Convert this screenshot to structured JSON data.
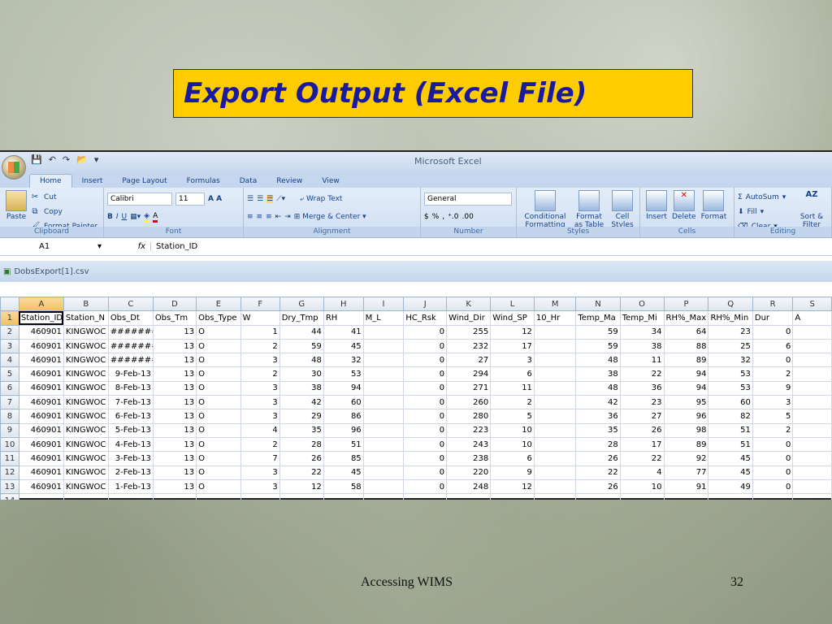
{
  "slide": {
    "title": "Export Output (Excel File)",
    "footer": "Accessing WIMS",
    "page": "32"
  },
  "excel": {
    "app_title": "Microsoft Excel",
    "tabs": [
      "Home",
      "Insert",
      "Page Layout",
      "Formulas",
      "Data",
      "Review",
      "View"
    ],
    "clipboard": {
      "paste": "Paste",
      "cut": "Cut",
      "copy": "Copy",
      "format_painter": "Format Painter",
      "label": "Clipboard"
    },
    "font": {
      "name": "Calibri",
      "size": "11",
      "bold": "B",
      "italic": "I",
      "underline": "U",
      "label": "Font"
    },
    "alignment": {
      "wrap": "Wrap Text",
      "merge": "Merge & Center",
      "label": "Alignment"
    },
    "number": {
      "format": "General",
      "currency": "$",
      "percent": "%",
      "comma": ",",
      "label": "Number"
    },
    "styles": {
      "conditional": "Conditional Formatting",
      "table": "Format as Table",
      "cell": "Cell Styles",
      "label": "Styles"
    },
    "cells": {
      "insert": "Insert",
      "delete": "Delete",
      "format": "Format",
      "label": "Cells"
    },
    "editing": {
      "autosum": "AutoSum",
      "fill": "Fill",
      "clear": "Clear",
      "sort": "Sort & Filter",
      "label": "Editing"
    },
    "name_box": "A1",
    "fx": "fx",
    "formula": "Station_ID",
    "workbook": "DobsExport[1].csv",
    "columns": [
      "A",
      "B",
      "C",
      "D",
      "E",
      "F",
      "G",
      "H",
      "I",
      "J",
      "K",
      "L",
      "M",
      "N",
      "O",
      "P",
      "Q",
      "R",
      "S"
    ],
    "rows": [
      [
        "Station_ID",
        "Station_N",
        "Obs_Dt",
        "Obs_Tm",
        "Obs_Type",
        "W",
        "Dry_Tmp",
        "RH",
        "M_L",
        "HC_Rsk",
        "Wind_Dir",
        "Wind_SP",
        "10_Hr",
        "Temp_Ma",
        "Temp_Mi",
        "RH%_Max",
        "RH%_Min",
        "Dur",
        "A"
      ],
      [
        "460901",
        "KINGWOC",
        "########",
        "13",
        "O",
        "1",
        "44",
        "41",
        "",
        "0",
        "255",
        "12",
        "",
        "59",
        "34",
        "64",
        "23",
        "0",
        ""
      ],
      [
        "460901",
        "KINGWOC",
        "########",
        "13",
        "O",
        "2",
        "59",
        "45",
        "",
        "0",
        "232",
        "17",
        "",
        "59",
        "38",
        "88",
        "25",
        "6",
        ""
      ],
      [
        "460901",
        "KINGWOC",
        "########",
        "13",
        "O",
        "3",
        "48",
        "32",
        "",
        "0",
        "27",
        "3",
        "",
        "48",
        "11",
        "89",
        "32",
        "0",
        ""
      ],
      [
        "460901",
        "KINGWOC",
        "9-Feb-13",
        "13",
        "O",
        "2",
        "30",
        "53",
        "",
        "0",
        "294",
        "6",
        "",
        "38",
        "22",
        "94",
        "53",
        "2",
        ""
      ],
      [
        "460901",
        "KINGWOC",
        "8-Feb-13",
        "13",
        "O",
        "3",
        "38",
        "94",
        "",
        "0",
        "271",
        "11",
        "",
        "48",
        "36",
        "94",
        "53",
        "9",
        ""
      ],
      [
        "460901",
        "KINGWOC",
        "7-Feb-13",
        "13",
        "O",
        "3",
        "42",
        "60",
        "",
        "0",
        "260",
        "2",
        "",
        "42",
        "23",
        "95",
        "60",
        "3",
        ""
      ],
      [
        "460901",
        "KINGWOC",
        "6-Feb-13",
        "13",
        "O",
        "3",
        "29",
        "86",
        "",
        "0",
        "280",
        "5",
        "",
        "36",
        "27",
        "96",
        "82",
        "5",
        ""
      ],
      [
        "460901",
        "KINGWOC",
        "5-Feb-13",
        "13",
        "O",
        "4",
        "35",
        "96",
        "",
        "0",
        "223",
        "10",
        "",
        "35",
        "26",
        "98",
        "51",
        "2",
        ""
      ],
      [
        "460901",
        "KINGWOC",
        "4-Feb-13",
        "13",
        "O",
        "2",
        "28",
        "51",
        "",
        "0",
        "243",
        "10",
        "",
        "28",
        "17",
        "89",
        "51",
        "0",
        ""
      ],
      [
        "460901",
        "KINGWOC",
        "3-Feb-13",
        "13",
        "O",
        "7",
        "26",
        "85",
        "",
        "0",
        "238",
        "6",
        "",
        "26",
        "22",
        "92",
        "45",
        "0",
        ""
      ],
      [
        "460901",
        "KINGWOC",
        "2-Feb-13",
        "13",
        "O",
        "3",
        "22",
        "45",
        "",
        "0",
        "220",
        "9",
        "",
        "22",
        "4",
        "77",
        "45",
        "0",
        ""
      ],
      [
        "460901",
        "KINGWOC",
        "1-Feb-13",
        "13",
        "O",
        "3",
        "12",
        "58",
        "",
        "0",
        "248",
        "12",
        "",
        "26",
        "10",
        "91",
        "49",
        "0",
        ""
      ]
    ]
  }
}
